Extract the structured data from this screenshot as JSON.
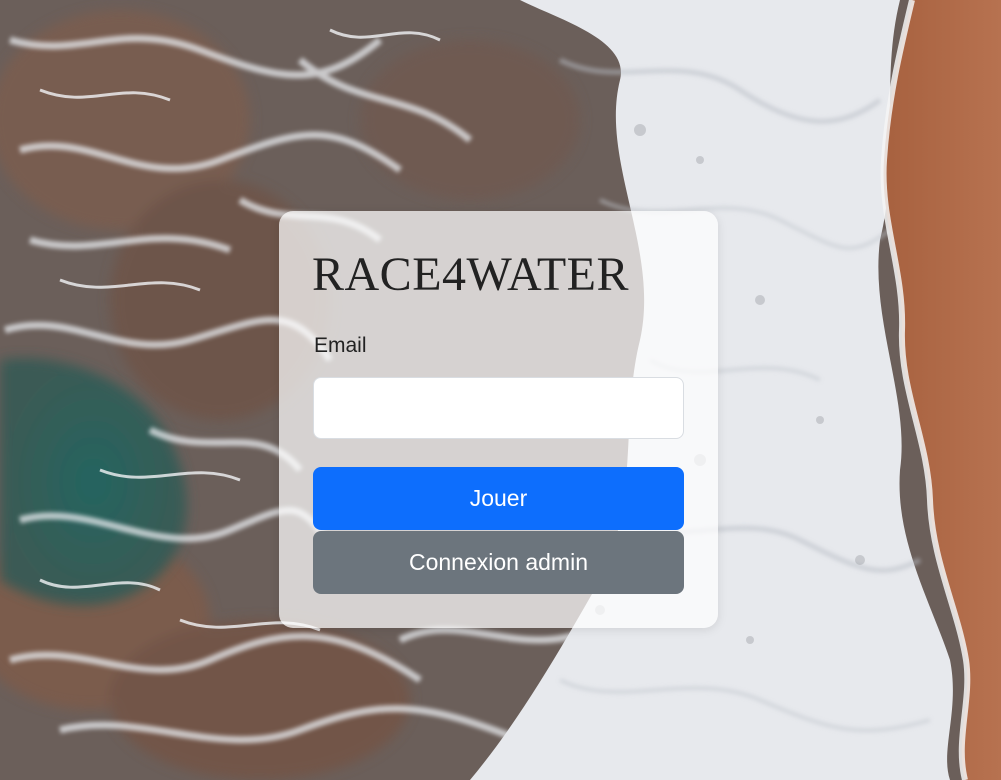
{
  "app": {
    "title": "RACE4WATER"
  },
  "form": {
    "email_label": "Email",
    "email_value": "",
    "email_placeholder": "",
    "play_button_label": "Jouer",
    "admin_button_label": "Connexion admin"
  },
  "colors": {
    "primary": "#0d6efd",
    "secondary": "#6c757d",
    "sand": "#b26a47",
    "deep_water": "#1f5a55",
    "foam": "#eef0f3"
  },
  "background": {
    "icon": "ocean-shore-aerial-photo"
  }
}
